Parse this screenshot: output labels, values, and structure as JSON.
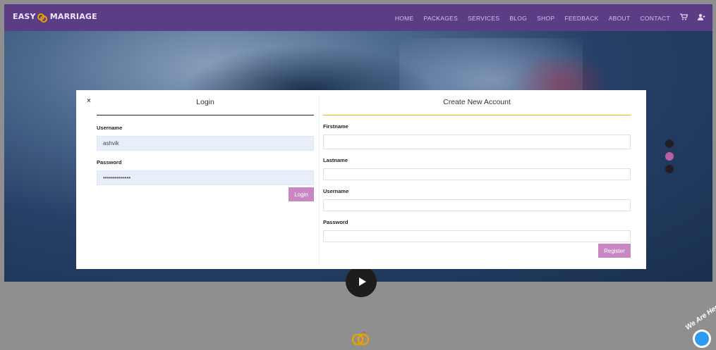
{
  "brand": {
    "left": "EASY",
    "right": "MARRIAGE"
  },
  "nav": {
    "items": [
      "HOME",
      "PACKAGES",
      "SERVICES",
      "BLOG",
      "SHOP",
      "FEEDBACK",
      "ABOUT",
      "CONTACT"
    ],
    "cart_icon": "cart-icon",
    "user_icon": "user-add-icon"
  },
  "modal": {
    "close_symbol": "×",
    "login": {
      "title": "Login",
      "username_label": "Username",
      "username_value": "ashvik",
      "password_label": "Password",
      "password_value": "••••••••••••••",
      "button": "Login"
    },
    "register": {
      "title": "Create New Account",
      "firstname_label": "Firstname",
      "lastname_label": "Lastname",
      "username_label": "Username",
      "password_label": "Password",
      "button": "Register"
    }
  },
  "carousel": {
    "slides": 3,
    "active": 2
  },
  "chat_widget": {
    "text": "We Are Her"
  },
  "colors": {
    "nav_bg": "#5b3d86",
    "button": "#c886c2",
    "accent_line": "#f0b400"
  }
}
